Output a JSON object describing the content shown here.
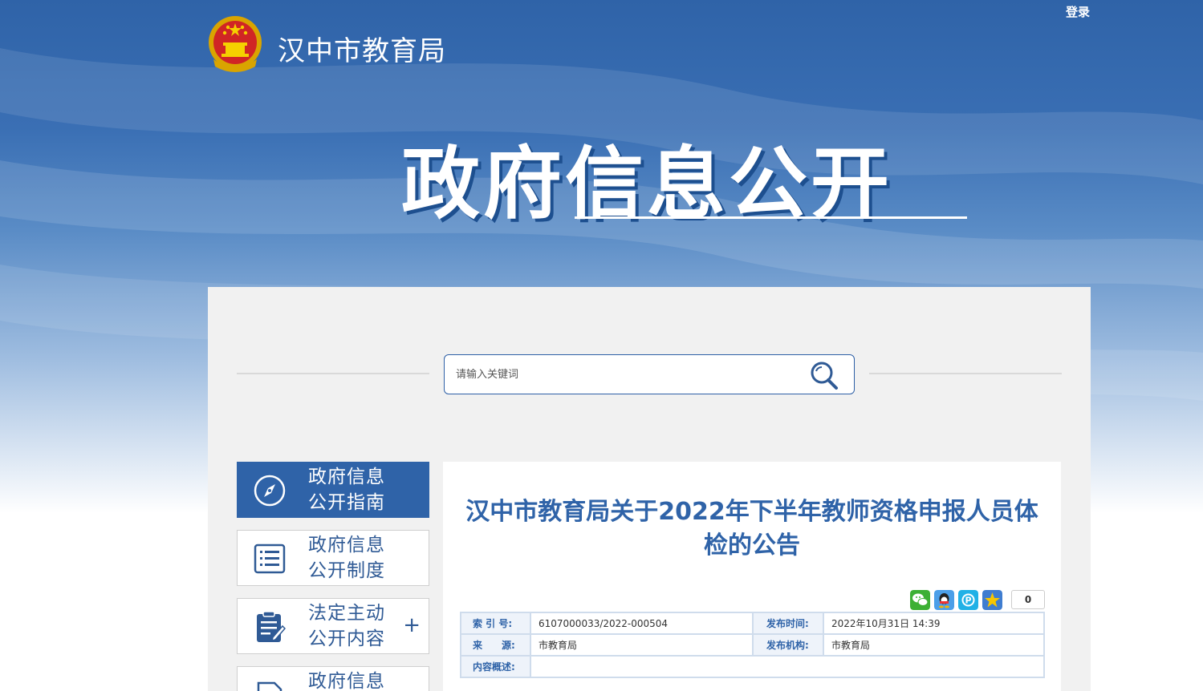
{
  "header": {
    "login_label": "登录",
    "site_name": "汉中市教育局",
    "banner_title": "政府信息公开"
  },
  "search": {
    "placeholder": "请输入关键词"
  },
  "sidebar": {
    "items": [
      {
        "line1": "政府信息",
        "line2": "公开指南",
        "icon": "compass-icon",
        "active": true
      },
      {
        "line1": "政府信息",
        "line2": "公开制度",
        "icon": "list-icon",
        "active": false
      },
      {
        "line1": "法定主动",
        "line2": "公开内容",
        "icon": "clipboard-icon",
        "active": false,
        "expand": "+"
      },
      {
        "line1": "政府信息",
        "line2": "",
        "icon": "document-icon",
        "active": false
      }
    ]
  },
  "article": {
    "title": "汉中市教育局关于2022年下半年教师资格申报人员体检的公告",
    "share_count": "0",
    "share_icons": [
      "wechat-icon",
      "qq-icon",
      "qzone-icon",
      "favorite-star-icon"
    ],
    "meta": {
      "index_label": "索 引 号:",
      "index_value": "6107000033/2022-000504",
      "time_label": "发布时间:",
      "time_value": "2022年10月31日 14:39",
      "source_label": "来　　源:",
      "source_value": "市教育局",
      "org_label": "发布机构:",
      "org_value": "市教育局",
      "summary_label": "内容概述:",
      "summary_value": ""
    }
  },
  "colors": {
    "primary": "#2f63a8",
    "banner_top": "#2f63a8",
    "panel_bg": "#f1f1f1",
    "table_border": "#cfdcec"
  }
}
